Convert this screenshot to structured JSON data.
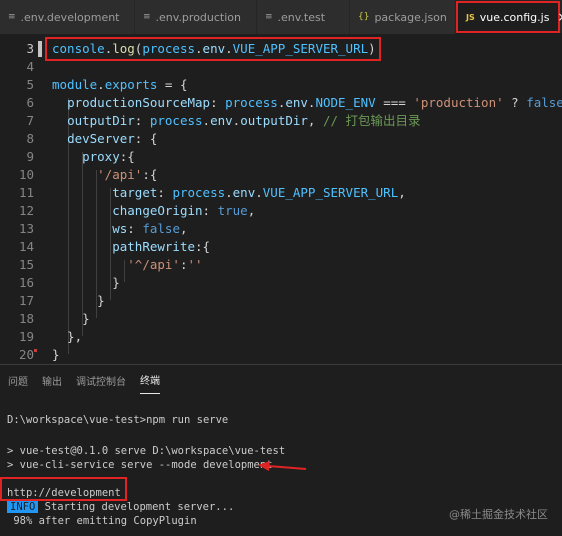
{
  "tabs": [
    {
      "label": ".env.development",
      "icon": "≡"
    },
    {
      "label": ".env.production",
      "icon": "≡"
    },
    {
      "label": ".env.test",
      "icon": "≡"
    },
    {
      "label": "package.json",
      "icon": "{}"
    },
    {
      "label": "vue.config.js",
      "icon": "JS",
      "close": "×"
    }
  ],
  "editor": {
    "line_numbers": [
      "3",
      "4",
      "5",
      "6",
      "7",
      "8",
      "9",
      "10",
      "11",
      "12",
      "13",
      "14",
      "15",
      "16",
      "17",
      "18",
      "19",
      "20"
    ],
    "comment": "// 打包输出目录"
  },
  "panel": {
    "tabs": [
      "问题",
      "输出",
      "调试控制台",
      "终端"
    ],
    "terminal": {
      "prompt": "D:\\workspace\\vue-test>npm run serve",
      "line1": "> vue-test@0.1.0 serve D:\\workspace\\vue-test",
      "line2": "> vue-cli-service serve --mode development",
      "url": "http://development",
      "info_badge": "INFO",
      "info_text": " Starting development server...",
      "progress": " 98% after emitting CopyPlugin"
    }
  },
  "watermark": "@稀土掘金技术社区",
  "colors": {
    "highlight_box": "#e02424",
    "info_badge": "#2196f3"
  }
}
